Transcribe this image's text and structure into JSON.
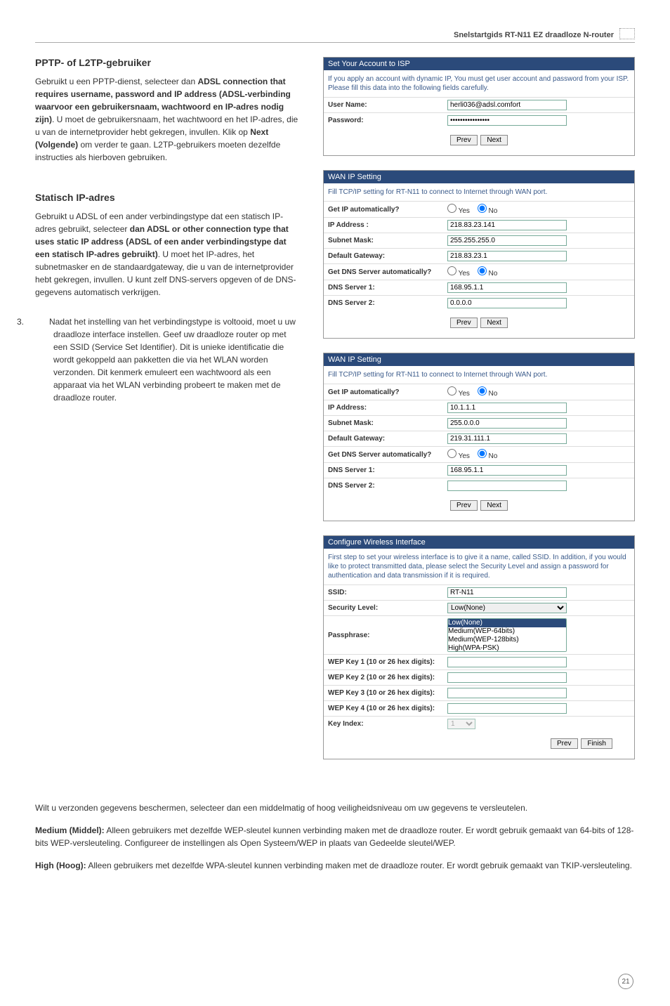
{
  "header_title": "Snelstartgids RT-N11 EZ draadloze N-router",
  "page_number": "21",
  "pptp": {
    "title": "PPTP- of L2TP-gebruiker",
    "body_pre": "Gebruikt u een PPTP-dienst, selecteer dan ",
    "bold1": "ADSL connection that requires username, password and IP address (ADSL-verbinding waarvoor een gebruikersnaam, wachtwoord en IP-adres nodig zijn)",
    "body_mid": ". U moet de gebruikersnaam, het wachtwoord en het IP-adres, die u van de internetprovider hebt gekregen, invullen. Klik op ",
    "bold2": "Next (Volgende)",
    "body_post": " om verder te gaan. L2TP-gebruikers moeten dezelfde instructies als hierboven gebruiken."
  },
  "static": {
    "title": "Statisch IP-adres",
    "body_pre": "Gebruikt u ADSL of een ander verbindingstype dat een statisch IP-adres gebruikt, selecteer ",
    "bold1": "dan ADSL or other connection type that uses static IP address (ADSL of een ander verbindingstype dat een statisch IP-adres gebruikt)",
    "body_post": ". U moet het IP-adres, het subnetmasker en de standaardgateway, die u van de internetprovider hebt gekregen, invullen. U kunt zelf DNS-servers opgeven of de DNS-gegevens automatisch verkrijgen."
  },
  "step3": {
    "num": "3.",
    "text": "Nadat het instelling van het verbindingstype is voltooid, moet u uw draadloze interface instellen. Geef uw draadloze router op met een SSID (Service Set Identifier). Dit is unieke identificatie die wordt gekoppeld aan pakketten die via het WLAN worden verzonden. Dit kenmerk emuleert een wachtwoord als een apparaat via het WLAN verbinding probeert te maken met de draadloze router."
  },
  "isp_panel": {
    "header": "Set Your Account to ISP",
    "desc": "If you apply an account with dynamic IP, You must get user account and password from your ISP. Please fill this data into the following fields carefully.",
    "user_label": "User Name:",
    "user_value": "herli036@adsl.comfort",
    "pass_label": "Password:",
    "pass_value": "••••••••••••••••",
    "prev": "Prev",
    "next": "Next"
  },
  "wan1": {
    "header": "WAN IP Setting",
    "desc": "Fill TCP/IP setting for RT-N11 to connect to Internet through WAN port.",
    "auto_label": "Get IP automatically?",
    "yes": "Yes",
    "no": "No",
    "ip_label": "IP Address :",
    "ip_value": "218.83.23.141",
    "mask_label": "Subnet Mask:",
    "mask_value": "255.255.255.0",
    "gw_label": "Default Gateway:",
    "gw_value": "218.83.23.1",
    "dnsauto_label": "Get DNS Server automatically?",
    "dns1_label": "DNS Server 1:",
    "dns1_value": "168.95.1.1",
    "dns2_label": "DNS Server 2:",
    "dns2_value": "0.0.0.0",
    "prev": "Prev",
    "next": "Next"
  },
  "wan2": {
    "header": "WAN IP Setting",
    "desc": "Fill TCP/IP setting for RT-N11 to connect to Internet through WAN port.",
    "auto_label": "Get IP automatically?",
    "yes": "Yes",
    "no": "No",
    "ip_label": "IP Address:",
    "ip_value": "10.1.1.1",
    "mask_label": "Subnet Mask:",
    "mask_value": "255.0.0.0",
    "gw_label": "Default Gateway:",
    "gw_value": "219.31.111.1",
    "dnsauto_label": "Get DNS Server automatically?",
    "dns1_label": "DNS Server 1:",
    "dns1_value": "168.95.1.1",
    "dns2_label": "DNS Server 2:",
    "dns2_value": "",
    "prev": "Prev",
    "next": "Next"
  },
  "wifi": {
    "header": "Configure Wireless Interface",
    "desc": "First step to set your wireless interface is to give it a name, called SSID. In addition, if you would like to protect transmitted data, please select the Security Level and assign a password for authentication and data transmission if it is required.",
    "ssid_label": "SSID:",
    "ssid_value": "RT-N11",
    "sec_label": "Security Level:",
    "sec_options": [
      "Low(None)",
      "Medium(WEP-64bits)",
      "Medium(WEP-128bits)",
      "High(WPA-PSK)"
    ],
    "pass_label": "Passphrase:",
    "k1": "WEP Key 1 (10 or 26 hex digits):",
    "k2": "WEP Key 2 (10 or 26 hex digits):",
    "k3": "WEP Key 3 (10 or 26 hex digits):",
    "k4": "WEP Key 4 (10 or 26 hex digits):",
    "key_index_label": "Key Index:",
    "key_index_value": "1",
    "prev": "Prev",
    "finish": "Finish"
  },
  "bottom": {
    "p1": "Wilt u verzonden gegevens beschermen, selecteer dan een middelmatig of hoog veiligheidsniveau om uw gegevens te versleutelen.",
    "medium_label": "Medium (Middel):",
    "medium_text": "  Alleen gebruikers met dezelfde WEP-sleutel kunnen verbinding maken met de draadloze router. Er wordt gebruik gemaakt van 64-bits of 128-bits WEP-versleuteling. Configureer de instellingen als Open Systeem/WEP in plaats van Gedeelde sleutel/WEP.",
    "high_label": "High (Hoog):",
    "high_text": "  Alleen gebruikers met dezelfde WPA-sleutel kunnen verbinding maken met de draadloze router. Er wordt gebruik gemaakt van TKIP-versleuteling."
  }
}
